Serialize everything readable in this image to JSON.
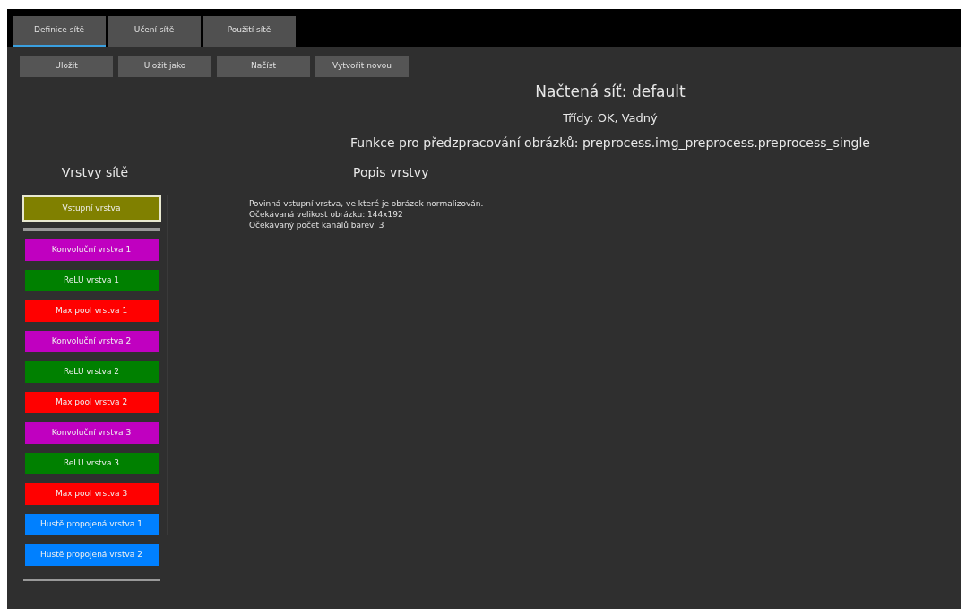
{
  "tabs": [
    {
      "label": "Definice sítě",
      "selected": true
    },
    {
      "label": "Učení sítě",
      "selected": false
    },
    {
      "label": "Použití sítě",
      "selected": false
    }
  ],
  "toolbar": [
    "Uložit",
    "Uložit jako",
    "Načíst",
    "Vytvořit novou"
  ],
  "network_title": "Načtená síť: default",
  "classes": "Třídy: OK, Vadný",
  "preprocess": "Funkce pro předzpracování obrázků: preprocess.img_preprocess.preprocess_single",
  "layers_heading": "Vrstvy sítě",
  "description_heading": "Popis vrstvy",
  "layers": [
    {
      "label": "Vstupní vrstva",
      "color": "#808000",
      "selected": true
    },
    {
      "label": "Konvoluční vrstva 1",
      "color": "#c000c0",
      "selected": false
    },
    {
      "label": "ReLU vrstva 1",
      "color": "#008000",
      "selected": false
    },
    {
      "label": "Max pool vrstva 1",
      "color": "#ff0000",
      "selected": false
    },
    {
      "label": "Konvoluční vrstva 2",
      "color": "#c000c0",
      "selected": false
    },
    {
      "label": "ReLU vrstva 2",
      "color": "#008000",
      "selected": false
    },
    {
      "label": "Max pool vrstva 2",
      "color": "#ff0000",
      "selected": false
    },
    {
      "label": "Konvoluční vrstva 3",
      "color": "#c000c0",
      "selected": false
    },
    {
      "label": "ReLU vrstva 3",
      "color": "#008000",
      "selected": false
    },
    {
      "label": "Max pool vrstva 3",
      "color": "#ff0000",
      "selected": false
    },
    {
      "label": "Hustě propojená vrstva 1",
      "color": "#0080ff",
      "selected": false
    },
    {
      "label": "Hustě propojená vrstva 2",
      "color": "#0080ff",
      "selected": false
    }
  ],
  "description": [
    "Povinná vstupní vrstva, ve které je obrázek normalizován.",
    "Očekávaná velikost obrázku: 144x192",
    "Očekávaný počet kanálů barev: 3"
  ]
}
